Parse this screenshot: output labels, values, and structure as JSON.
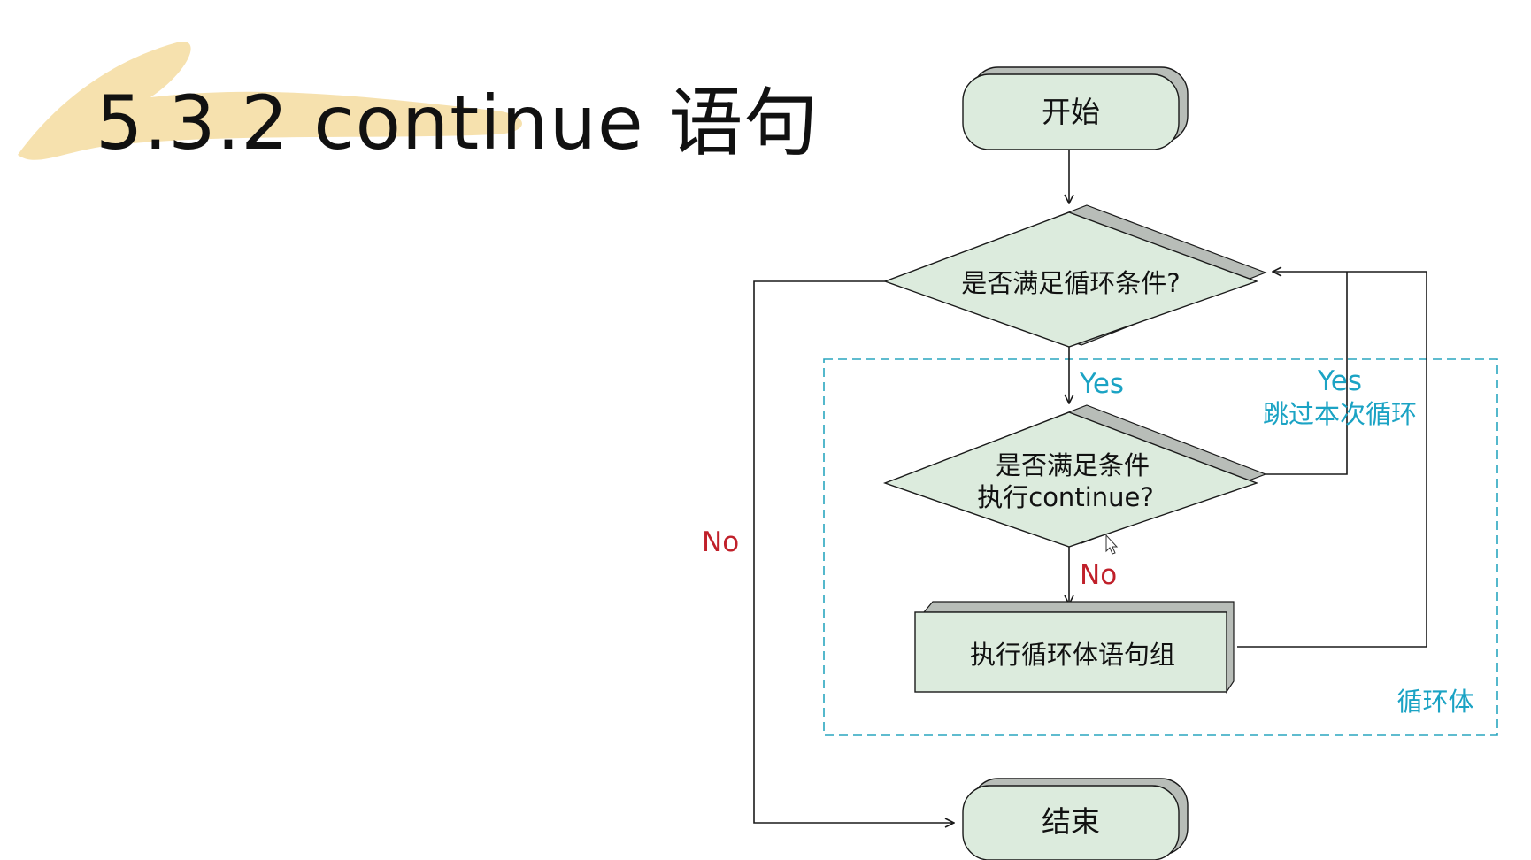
{
  "slide": {
    "title": "5.3.2 continue 语句"
  },
  "flowchart": {
    "start": "开始",
    "condition_loop": "是否满足循环条件?",
    "condition_continue_line1": "是否满足条件",
    "condition_continue_line2": "执行continue?",
    "loop_body_statements": "执行循环体语句组",
    "end": "结束",
    "label_yes_loop": "Yes",
    "label_no_loop": "No",
    "label_yes_continue": "Yes",
    "label_skip": "跳过本次循环",
    "label_no_continue": "No",
    "region_label": "循环体"
  },
  "colors": {
    "node_fill": "#dcebdd",
    "node_shadow": "#b8bdb8",
    "line": "#1a1a1a",
    "yes_label": "#1ba3c4",
    "no_label": "#c0202a",
    "dashed_region": "#2aa6bf",
    "highlight": "#f5dca0"
  }
}
